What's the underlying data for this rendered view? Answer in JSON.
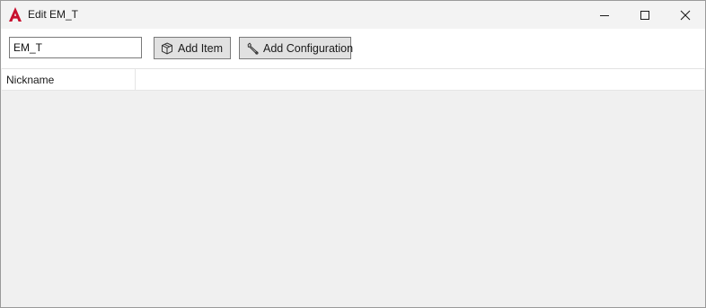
{
  "window": {
    "title": "Edit EM_T",
    "app_icon": "autocad-icon",
    "controls": [
      "minimize-icon",
      "maximize-icon",
      "close-icon"
    ]
  },
  "toolbar": {
    "name_value": "EM_T",
    "add_item_label": "Add Item",
    "add_item_icon": "cube-icon",
    "add_configuration_label": "Add Configuration",
    "add_configuration_icon": "wrench-icon"
  },
  "list": {
    "columns": [
      "Nickname"
    ],
    "rows": []
  },
  "colors": {
    "app_icon_red": "#c8102e",
    "button_face": "#e1e1e1",
    "content_background": "#f0f0f0"
  }
}
